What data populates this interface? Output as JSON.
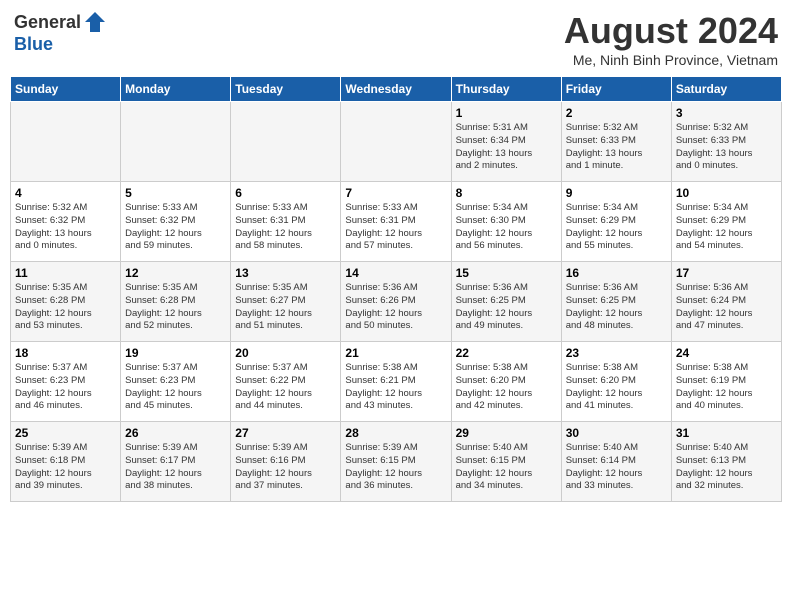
{
  "header": {
    "logo": {
      "general": "General",
      "blue": "Blue"
    },
    "title": "August 2024",
    "location": "Me, Ninh Binh Province, Vietnam"
  },
  "days_of_week": [
    "Sunday",
    "Monday",
    "Tuesday",
    "Wednesday",
    "Thursday",
    "Friday",
    "Saturday"
  ],
  "weeks": [
    [
      {
        "day": "",
        "info": ""
      },
      {
        "day": "",
        "info": ""
      },
      {
        "day": "",
        "info": ""
      },
      {
        "day": "",
        "info": ""
      },
      {
        "day": "1",
        "info": "Sunrise: 5:31 AM\nSunset: 6:34 PM\nDaylight: 13 hours\nand 2 minutes."
      },
      {
        "day": "2",
        "info": "Sunrise: 5:32 AM\nSunset: 6:33 PM\nDaylight: 13 hours\nand 1 minute."
      },
      {
        "day": "3",
        "info": "Sunrise: 5:32 AM\nSunset: 6:33 PM\nDaylight: 13 hours\nand 0 minutes."
      }
    ],
    [
      {
        "day": "4",
        "info": "Sunrise: 5:32 AM\nSunset: 6:32 PM\nDaylight: 13 hours\nand 0 minutes."
      },
      {
        "day": "5",
        "info": "Sunrise: 5:33 AM\nSunset: 6:32 PM\nDaylight: 12 hours\nand 59 minutes."
      },
      {
        "day": "6",
        "info": "Sunrise: 5:33 AM\nSunset: 6:31 PM\nDaylight: 12 hours\nand 58 minutes."
      },
      {
        "day": "7",
        "info": "Sunrise: 5:33 AM\nSunset: 6:31 PM\nDaylight: 12 hours\nand 57 minutes."
      },
      {
        "day": "8",
        "info": "Sunrise: 5:34 AM\nSunset: 6:30 PM\nDaylight: 12 hours\nand 56 minutes."
      },
      {
        "day": "9",
        "info": "Sunrise: 5:34 AM\nSunset: 6:29 PM\nDaylight: 12 hours\nand 55 minutes."
      },
      {
        "day": "10",
        "info": "Sunrise: 5:34 AM\nSunset: 6:29 PM\nDaylight: 12 hours\nand 54 minutes."
      }
    ],
    [
      {
        "day": "11",
        "info": "Sunrise: 5:35 AM\nSunset: 6:28 PM\nDaylight: 12 hours\nand 53 minutes."
      },
      {
        "day": "12",
        "info": "Sunrise: 5:35 AM\nSunset: 6:28 PM\nDaylight: 12 hours\nand 52 minutes."
      },
      {
        "day": "13",
        "info": "Sunrise: 5:35 AM\nSunset: 6:27 PM\nDaylight: 12 hours\nand 51 minutes."
      },
      {
        "day": "14",
        "info": "Sunrise: 5:36 AM\nSunset: 6:26 PM\nDaylight: 12 hours\nand 50 minutes."
      },
      {
        "day": "15",
        "info": "Sunrise: 5:36 AM\nSunset: 6:25 PM\nDaylight: 12 hours\nand 49 minutes."
      },
      {
        "day": "16",
        "info": "Sunrise: 5:36 AM\nSunset: 6:25 PM\nDaylight: 12 hours\nand 48 minutes."
      },
      {
        "day": "17",
        "info": "Sunrise: 5:36 AM\nSunset: 6:24 PM\nDaylight: 12 hours\nand 47 minutes."
      }
    ],
    [
      {
        "day": "18",
        "info": "Sunrise: 5:37 AM\nSunset: 6:23 PM\nDaylight: 12 hours\nand 46 minutes."
      },
      {
        "day": "19",
        "info": "Sunrise: 5:37 AM\nSunset: 6:23 PM\nDaylight: 12 hours\nand 45 minutes."
      },
      {
        "day": "20",
        "info": "Sunrise: 5:37 AM\nSunset: 6:22 PM\nDaylight: 12 hours\nand 44 minutes."
      },
      {
        "day": "21",
        "info": "Sunrise: 5:38 AM\nSunset: 6:21 PM\nDaylight: 12 hours\nand 43 minutes."
      },
      {
        "day": "22",
        "info": "Sunrise: 5:38 AM\nSunset: 6:20 PM\nDaylight: 12 hours\nand 42 minutes."
      },
      {
        "day": "23",
        "info": "Sunrise: 5:38 AM\nSunset: 6:20 PM\nDaylight: 12 hours\nand 41 minutes."
      },
      {
        "day": "24",
        "info": "Sunrise: 5:38 AM\nSunset: 6:19 PM\nDaylight: 12 hours\nand 40 minutes."
      }
    ],
    [
      {
        "day": "25",
        "info": "Sunrise: 5:39 AM\nSunset: 6:18 PM\nDaylight: 12 hours\nand 39 minutes."
      },
      {
        "day": "26",
        "info": "Sunrise: 5:39 AM\nSunset: 6:17 PM\nDaylight: 12 hours\nand 38 minutes."
      },
      {
        "day": "27",
        "info": "Sunrise: 5:39 AM\nSunset: 6:16 PM\nDaylight: 12 hours\nand 37 minutes."
      },
      {
        "day": "28",
        "info": "Sunrise: 5:39 AM\nSunset: 6:15 PM\nDaylight: 12 hours\nand 36 minutes."
      },
      {
        "day": "29",
        "info": "Sunrise: 5:40 AM\nSunset: 6:15 PM\nDaylight: 12 hours\nand 34 minutes."
      },
      {
        "day": "30",
        "info": "Sunrise: 5:40 AM\nSunset: 6:14 PM\nDaylight: 12 hours\nand 33 minutes."
      },
      {
        "day": "31",
        "info": "Sunrise: 5:40 AM\nSunset: 6:13 PM\nDaylight: 12 hours\nand 32 minutes."
      }
    ]
  ]
}
